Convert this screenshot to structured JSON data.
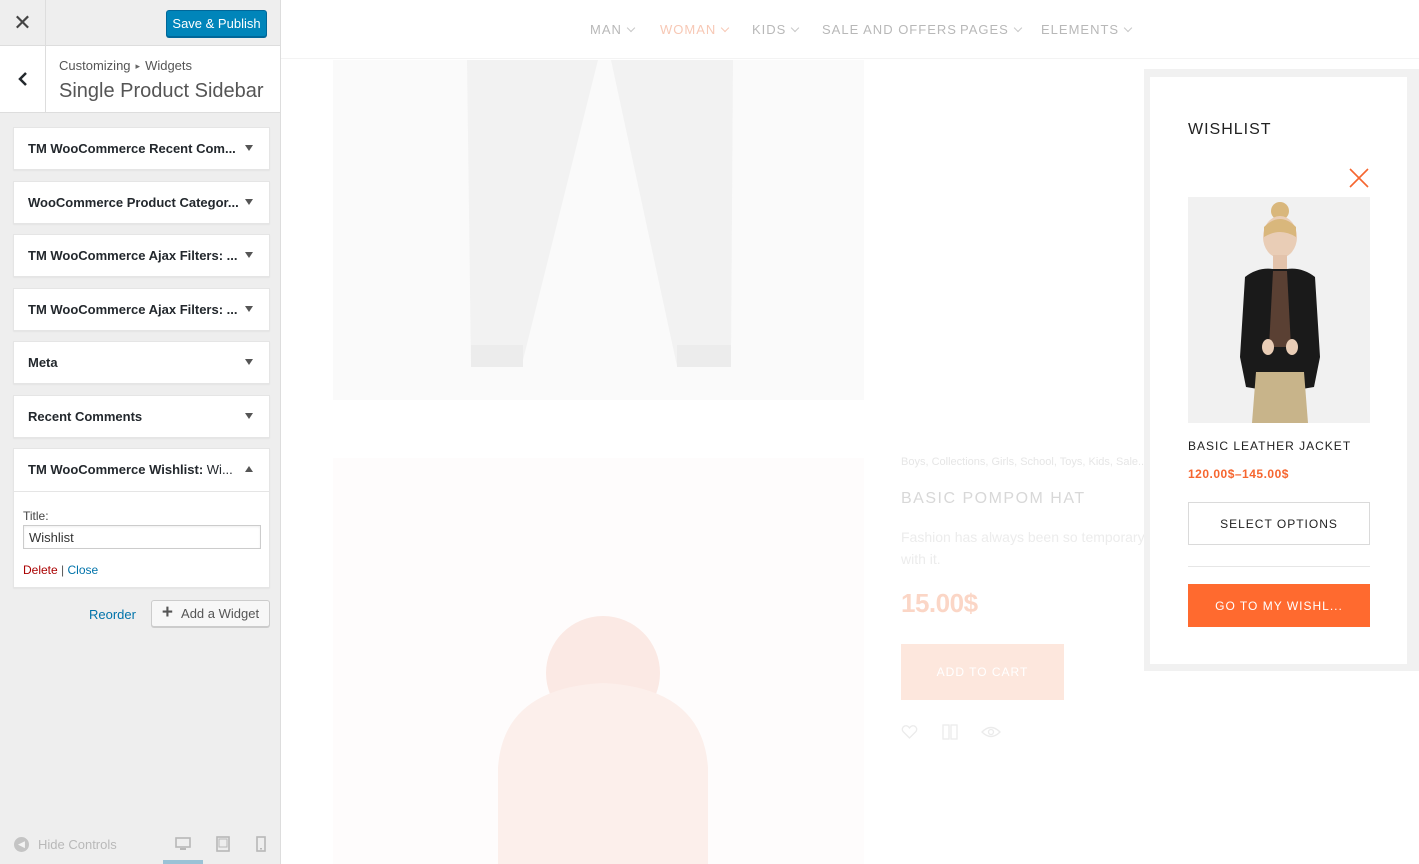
{
  "customizer": {
    "close_icon": "close-icon",
    "save_label": "Save & Publish",
    "breadcrumb": {
      "root": "Customizing",
      "separator": "▸",
      "current": "Widgets"
    },
    "section_title": "Single Product Sidebar",
    "widgets": [
      {
        "title": "TM WooCommerce Recent Com...",
        "expanded": false
      },
      {
        "title": "WooCommerce Product Categor...",
        "expanded": false
      },
      {
        "title": "TM WooCommerce Ajax Filters: ...",
        "expanded": false
      },
      {
        "title": "TM WooCommerce Ajax Filters: ...",
        "expanded": false
      },
      {
        "title": "Meta",
        "expanded": false
      },
      {
        "title": "Recent Comments",
        "expanded": false
      },
      {
        "title": "TM WooCommerce Wishlist:",
        "subtitle": " Wi...",
        "expanded": true
      }
    ],
    "widget_form": {
      "title_label": "Title:",
      "title_value": "Wishlist",
      "delete_label": "Delete",
      "separator": "|",
      "close_label": "Close"
    },
    "reorder_label": "Reorder",
    "add_widget_label": "Add a Widget",
    "hide_controls_label": "Hide Controls",
    "devices": [
      "desktop",
      "tablet",
      "mobile"
    ],
    "accent_color": "#0085ba"
  },
  "preview": {
    "nav": [
      {
        "label": "MAN",
        "dropdown": true,
        "active": false
      },
      {
        "label": "WOMAN",
        "dropdown": true,
        "active": true
      },
      {
        "label": "KIDS",
        "dropdown": true,
        "active": false
      },
      {
        "label": "SALE AND OFFERS",
        "dropdown": false,
        "active": false
      },
      {
        "label": "PAGES",
        "dropdown": true,
        "active": false
      },
      {
        "label": "ELEMENTS",
        "dropdown": true,
        "active": false
      }
    ],
    "product": {
      "categories": "Boys, Collections, Girls, School, Toys, Kids, Sale...",
      "name": "BASIC POMPOM HAT",
      "description": "Fashion has always been so temporary with it.",
      "price": "15.00$",
      "add_to_cart": "ADD TO CART"
    },
    "wishlist": {
      "title": "WISHLIST",
      "item_name": "BASIC LEATHER JACKET",
      "item_price": "120.00$–145.00$",
      "select_options": "SELECT OPTIONS",
      "go_to": "GO TO MY WISHL...",
      "accent_color": "#ff6a2f"
    }
  }
}
